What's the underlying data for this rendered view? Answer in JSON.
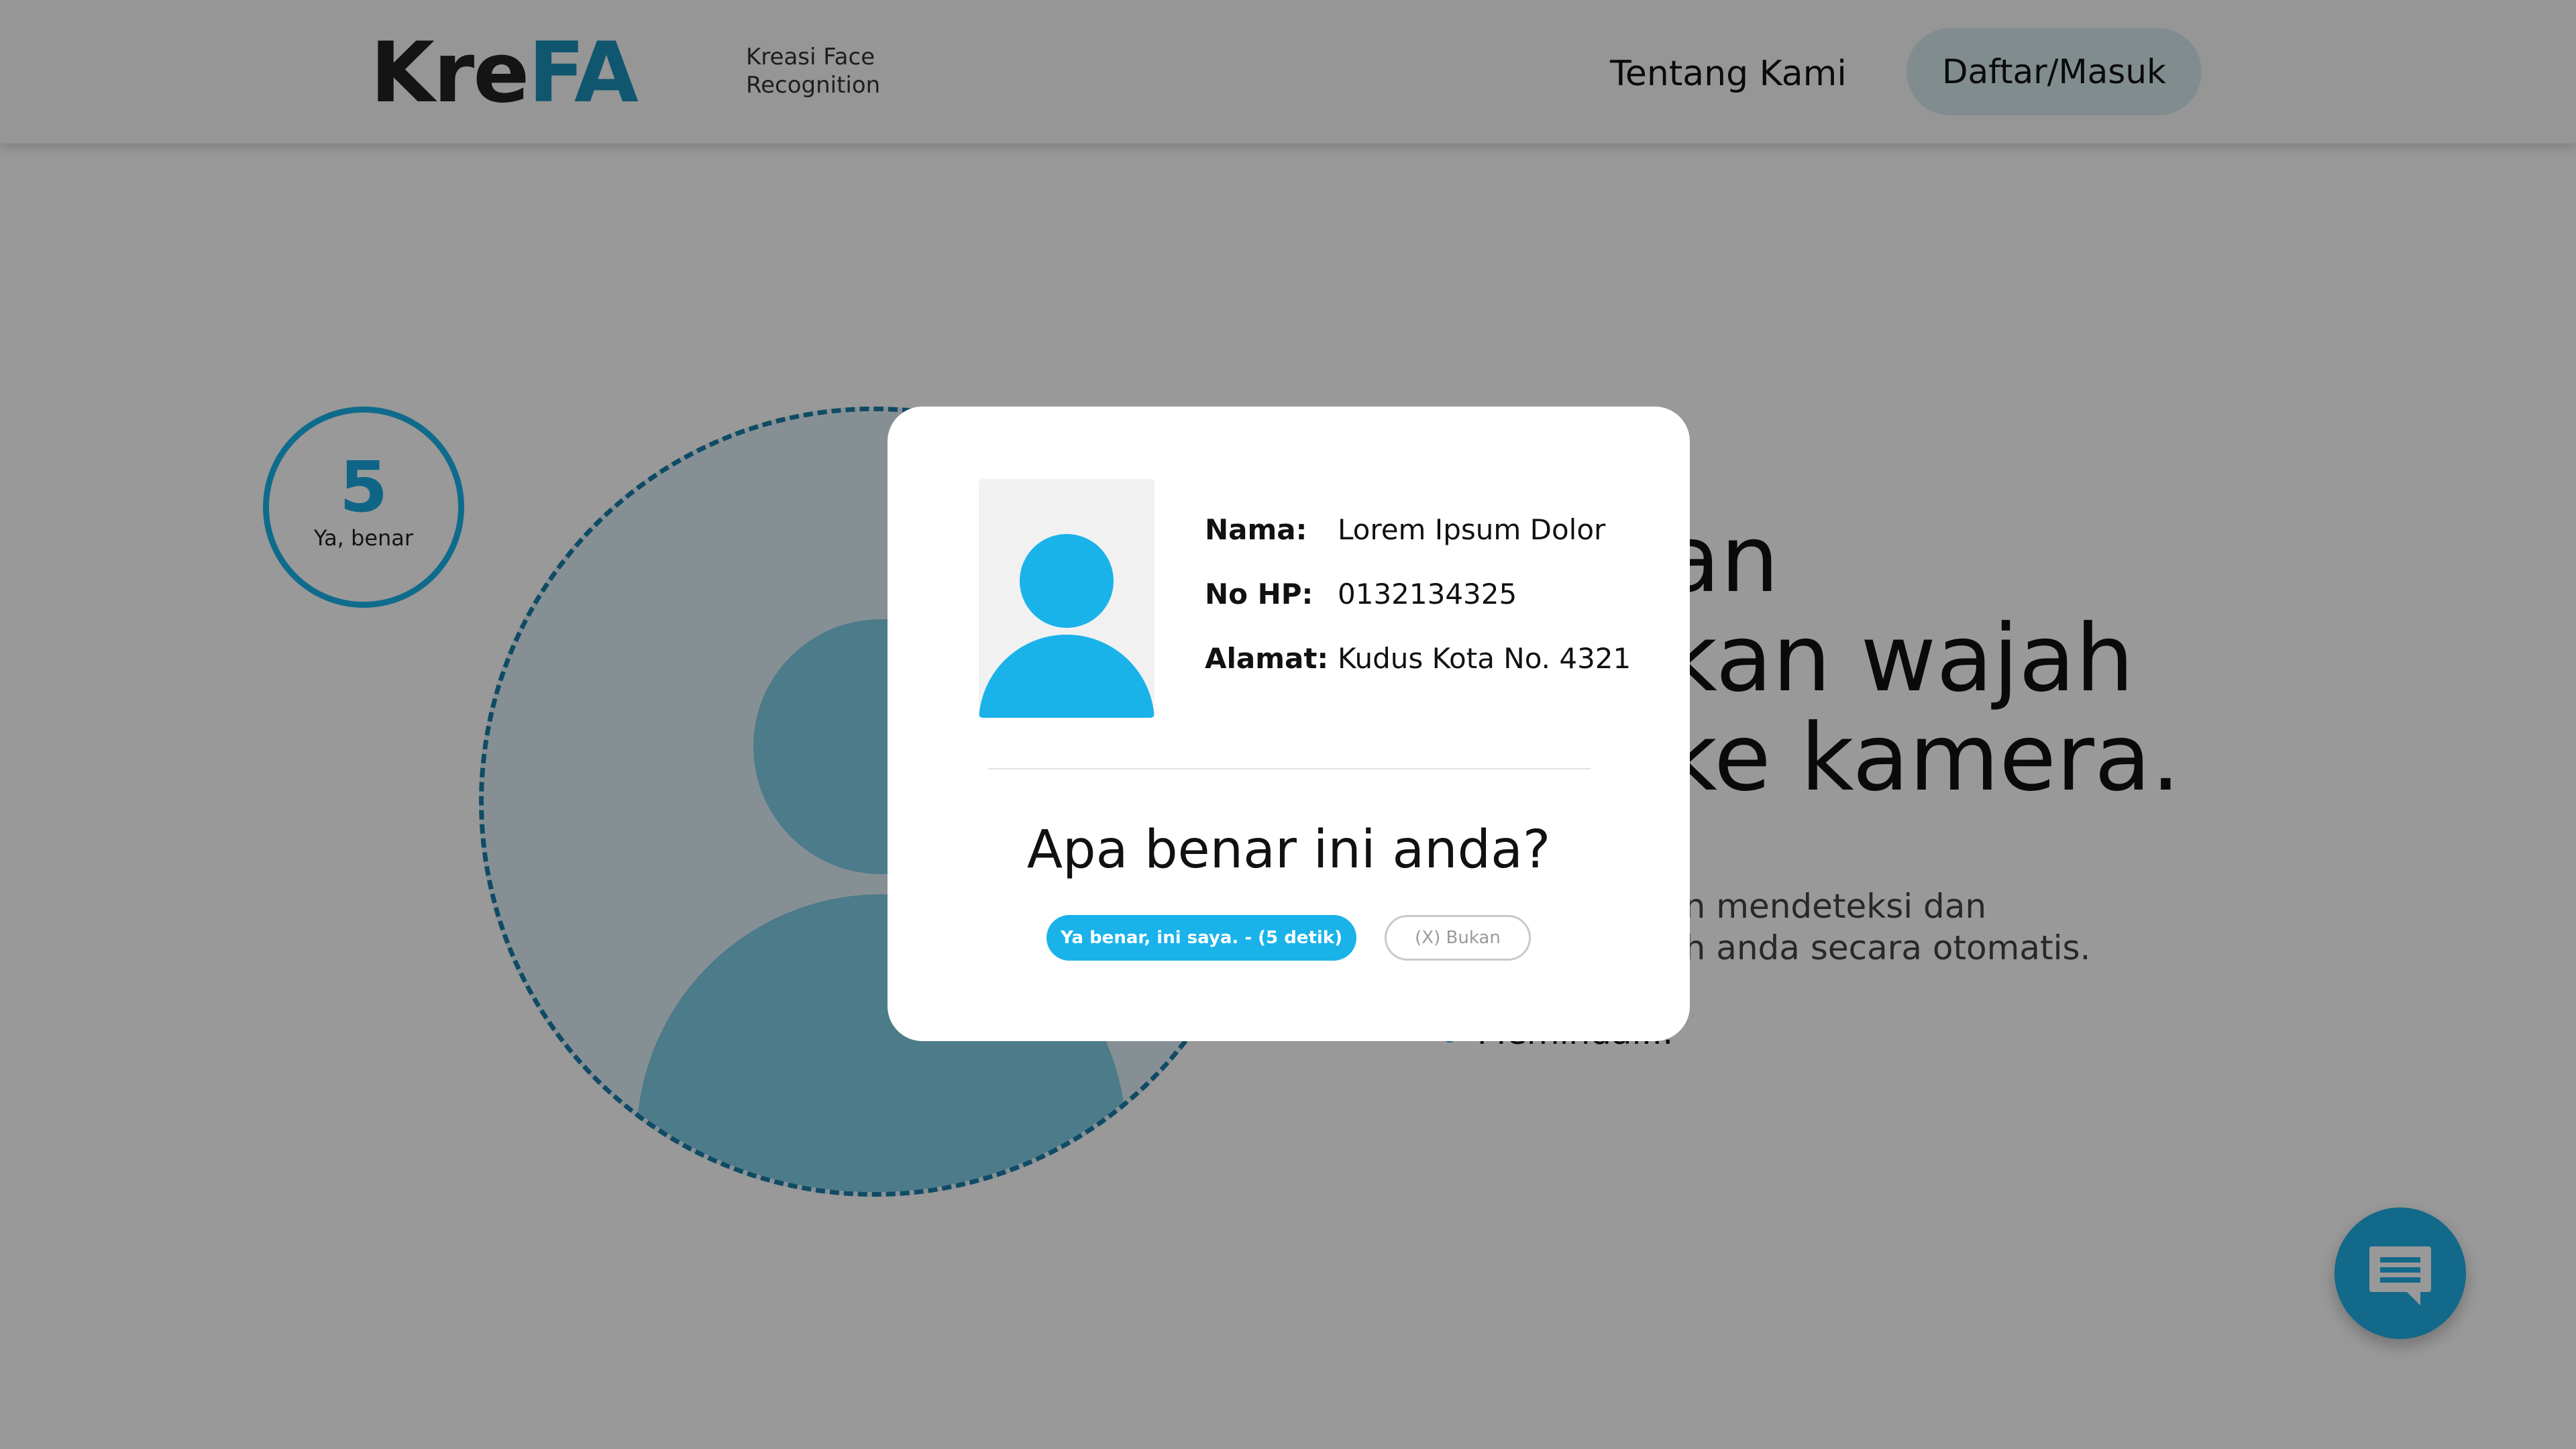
{
  "navbar": {
    "logo_part1": "Kre",
    "logo_part2": "FA",
    "tagline_line1": "Kreasi Face",
    "tagline_line2": "Recognition",
    "about_link": "Tentang Kami",
    "auth_button": "Daftar/Masuk"
  },
  "counter": {
    "number": "5",
    "label": "Ya, benar"
  },
  "hero": {
    "title_line1": "an",
    "title_line2": "kan wajah",
    "title_line3": "ke kamera.",
    "desc_line1": "an mendeteksi dan",
    "desc_line2": "ah anda secara otomatis.",
    "status": "Memindai..."
  },
  "modal": {
    "info": [
      {
        "label": "Nama:",
        "value": "Lorem Ipsum Dolor"
      },
      {
        "label": "No HP:",
        "value": "0132134325"
      },
      {
        "label": "Alamat:",
        "value": "Kudus Kota No. 4321"
      }
    ],
    "question": "Apa benar ini anda?",
    "confirm_button": "Ya benar, ini saya. - (5 detik)",
    "reject_button": "(X) Bukan"
  },
  "colors": {
    "brand_dark": "#222222",
    "brand_blue": "#1a8fb8",
    "accent": "#19b3ea",
    "overlay": "rgba(0,0,0,0.40)"
  },
  "icons": {
    "chat": "chat-bubble-icon",
    "avatar": "user-avatar-icon"
  }
}
